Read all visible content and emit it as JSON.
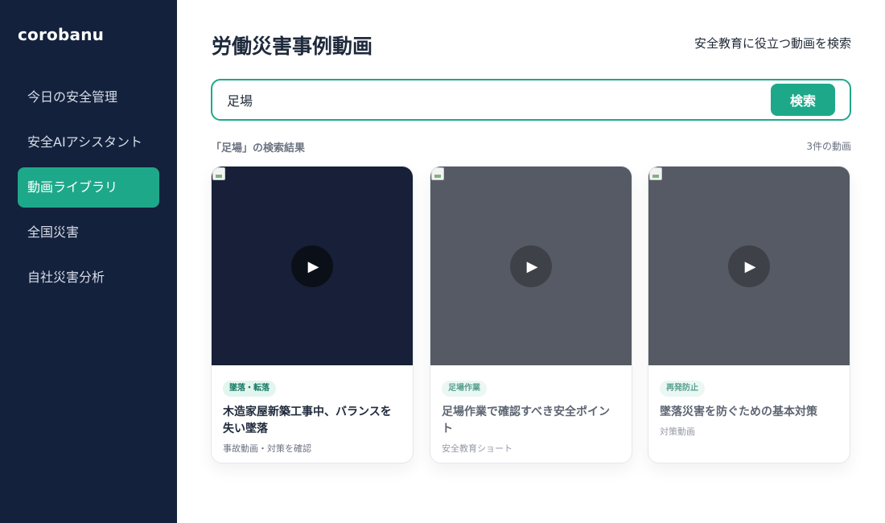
{
  "sidebar": {
    "brand": "corobanu",
    "items": [
      {
        "label": "今日の安全管理"
      },
      {
        "label": "安全AIアシスタント"
      },
      {
        "label": "動画ライブラリ"
      },
      {
        "label": "全国災害"
      },
      {
        "label": "自社災害分析"
      }
    ],
    "active_index": 2
  },
  "header": {
    "title": "労働災害事例動画",
    "subtitle": "安全教育に役立つ動画を検索"
  },
  "search": {
    "value": "足場",
    "button_label": "検索"
  },
  "results": {
    "label": "「足場」の検索結果",
    "count": "3件の動画"
  },
  "videos": [
    {
      "tag": "墜落・転落",
      "title": "木造家屋新築工事中、バランスを失い墜落",
      "meta": "事故動画・対策を確認",
      "play_icon": "▶"
    },
    {
      "tag": "足場作業",
      "title": "足場作業で確認すべき安全ポイント",
      "meta": "安全教育ショート",
      "play_icon": "▶"
    },
    {
      "tag": "再発防止",
      "title": "墜落災害を防ぐための基本対策",
      "meta": "対策動画",
      "play_icon": "▶"
    }
  ],
  "colors": {
    "sidebar_bg": "#13213c",
    "accent": "#1ea88a",
    "thumb_dark": "#172038",
    "thumb_gray": "#555a64"
  }
}
